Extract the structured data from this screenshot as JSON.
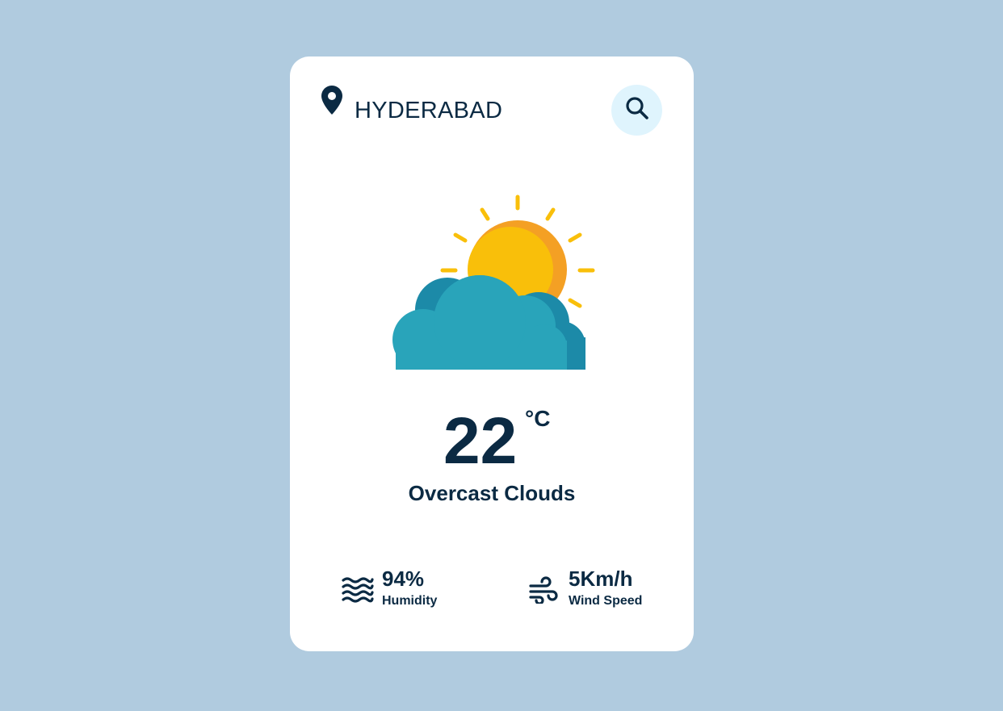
{
  "location": {
    "city": "HYDERABAD",
    "icon": "map-pin-icon"
  },
  "search": {
    "icon": "search-icon"
  },
  "weather": {
    "icon": "sun-behind-cloud-icon",
    "temperature": "22",
    "unit": "°C",
    "description": "Overcast Clouds"
  },
  "details": {
    "humidity": {
      "icon": "humidity-waves-icon",
      "value": "94%",
      "label": "Humidity"
    },
    "wind": {
      "icon": "wind-icon",
      "value": "5Km/h",
      "label": "Wind Speed"
    }
  },
  "colors": {
    "background": "#b0cbdf",
    "card": "#ffffff",
    "text": "#0b2a43",
    "search_button_bg": "#dff4fd",
    "sun": "#f9bf0a",
    "sun_shade": "#f4a024",
    "cloud": "#29a4ba",
    "cloud_shade": "#1c8aa8"
  }
}
